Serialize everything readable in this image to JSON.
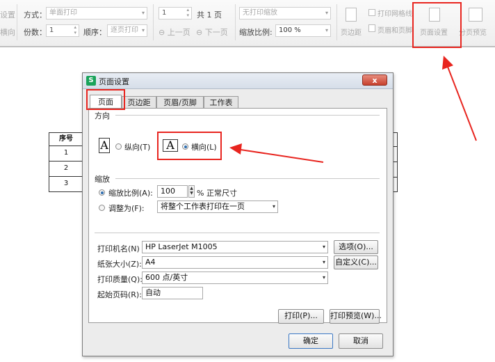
{
  "toolbar": {
    "left_cut_1": "设置",
    "left_cut_2": "横向",
    "mode_label": "方式：",
    "mode_value": "单面打印",
    "copies_label": "份数：",
    "copies_value": "1",
    "order_label": "顺序：",
    "order_value": "逐页打印",
    "page_value": "1",
    "page_total": "共 1 页",
    "prev_page": "上一页",
    "next_page": "下一页",
    "scale_mode": "无打印缩放",
    "zoom_label": "缩放比例:",
    "zoom_value": "100 %",
    "margin_btn": "页边距",
    "print_grid": "打印网格线",
    "header_footer": "页眉和页脚",
    "page_setup": "页面设置",
    "page_preview": "分页预览"
  },
  "sheet": {
    "header": "序号",
    "rows": [
      "1",
      "2",
      "3"
    ]
  },
  "dialog": {
    "title": "页面设置",
    "close": "x",
    "tabs": [
      "页面",
      "页边距",
      "页眉/页脚",
      "工作表"
    ],
    "orientation": {
      "group": "方向",
      "portrait": "纵向(T)",
      "landscape": "横向(L)",
      "icon_letter": "A"
    },
    "scaling": {
      "group": "缩放",
      "ratio_label": "缩放比例(A):",
      "ratio_value": "100",
      "ratio_suffix": "% 正常尺寸",
      "fit_label": "调整为(F):",
      "fit_value": "将整个工作表打印在一页"
    },
    "printer_label": "打印机名(N)",
    "printer_value": "HP LaserJet M1005",
    "options_btn": "选项(O)...",
    "paper_label": "纸张大小(Z):",
    "paper_value": "A4",
    "custom_btn": "自定义(C)...",
    "quality_label": "打印质量(Q):",
    "quality_value": "600 点/英寸",
    "start_label": "起始页码(R):",
    "start_value": "自动",
    "print_btn": "打印(P)...",
    "preview_btn": "打印预览(W)...",
    "ok_btn": "确定",
    "cancel_btn": "取消"
  },
  "colors": {
    "highlight": "#e8251f",
    "accent": "#2f6fb0"
  }
}
